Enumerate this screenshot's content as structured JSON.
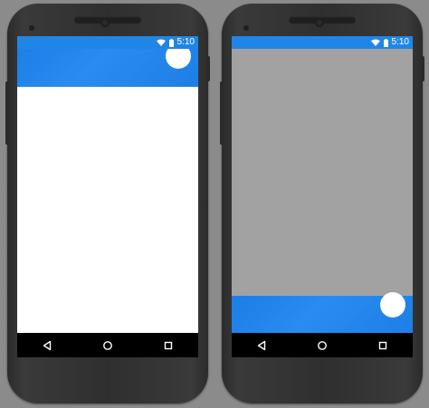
{
  "screens": [
    {
      "id": "left",
      "status": {
        "time": "5:10"
      },
      "nav": {
        "back": "back-icon",
        "home": "home-icon",
        "recents": "recents-icon"
      }
    },
    {
      "id": "right",
      "status": {
        "time": "5:10"
      },
      "nav": {
        "back": "back-icon",
        "home": "home-icon",
        "recents": "recents-icon"
      }
    }
  ],
  "colors": {
    "primary": "#1f86e8",
    "scrim": "#a2a2a2",
    "background": "#8b8b8b"
  }
}
